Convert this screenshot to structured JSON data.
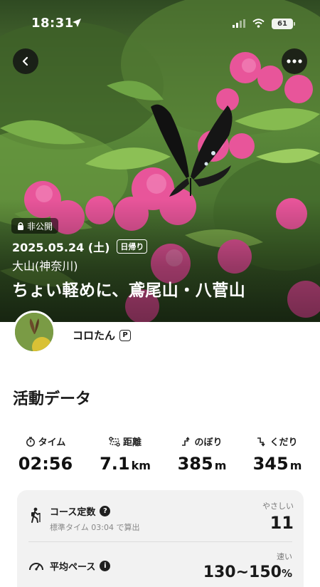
{
  "status_bar": {
    "time": "18:31",
    "battery": "61",
    "icons": [
      "location-arrow-icon",
      "cellular-signal-icon",
      "wifi-icon",
      "battery-icon"
    ]
  },
  "hero": {
    "private_label": "非公開",
    "date": "2025.05.24 (土)",
    "day_trip_label": "日帰り",
    "area": "大山(神奈川)",
    "title": "ちょい軽めに、鳶尾山・八菅山",
    "icons": [
      "back-arrow-icon",
      "more-dots-icon",
      "lock-icon"
    ]
  },
  "user": {
    "name": "コロたん",
    "premium_badge": "P"
  },
  "activity": {
    "section_title": "活動データ",
    "stats": [
      {
        "label": "タイム",
        "value": "02:56",
        "unit": "",
        "icon": "stopwatch-icon"
      },
      {
        "label": "距離",
        "value": "7.1",
        "unit": "km",
        "icon": "route-icon"
      },
      {
        "label": "のぼり",
        "value": "385",
        "unit": "m",
        "icon": "ascent-icon"
      },
      {
        "label": "くだり",
        "value": "345",
        "unit": "m",
        "icon": "descent-icon"
      }
    ]
  },
  "course": {
    "title": "コース定数",
    "subtitle": "標準タイム 03:04 で算出",
    "rating": "やさしい",
    "value": "11",
    "icon": "hiker-icon"
  },
  "pace": {
    "title": "平均ペース",
    "rating": "速い",
    "value": "130~150",
    "unit": "%",
    "icon": "speedometer-icon"
  },
  "colors": {
    "accent_dark": "#1f1f1f",
    "card_bg": "#f2f2f2",
    "hero_green": "#4f7a33",
    "azalea_pink": "#e8559a"
  }
}
